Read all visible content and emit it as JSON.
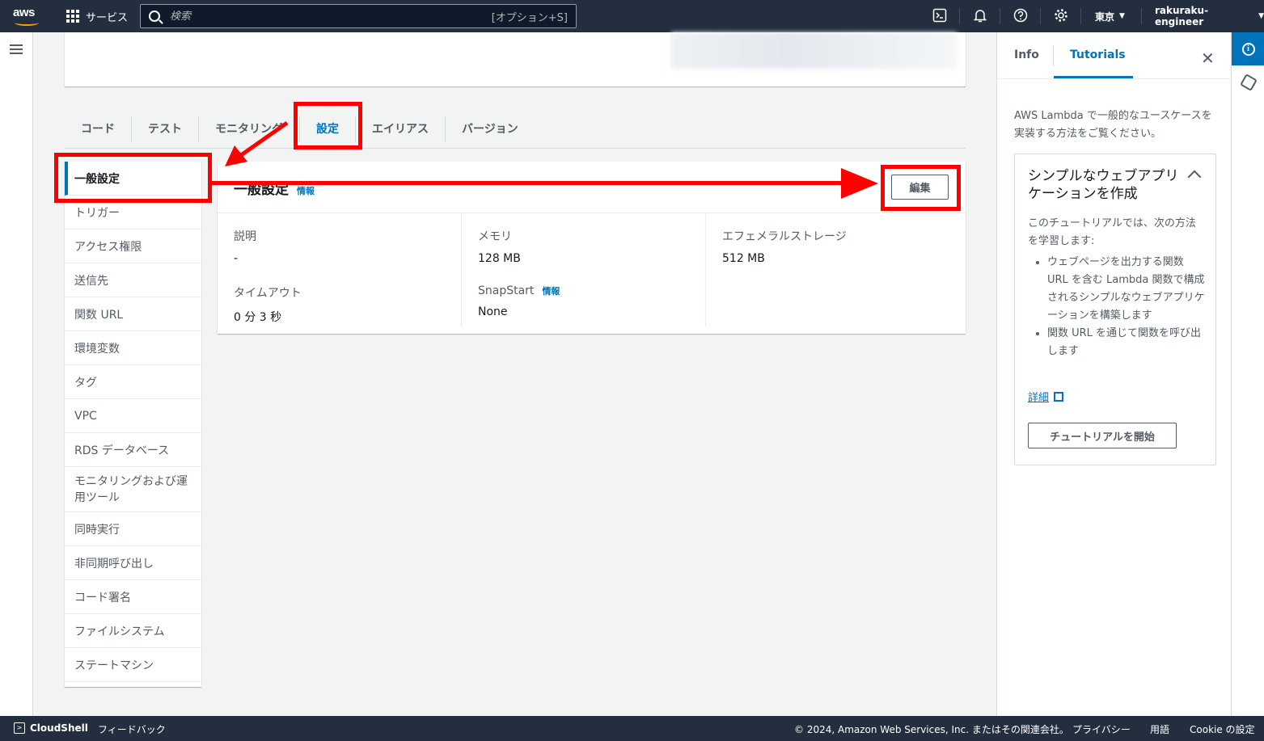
{
  "topnav": {
    "logo": "aws",
    "services_label": "サービス",
    "search_placeholder": "検索",
    "search_shortcut": "[オプション+S]",
    "region_label": "東京",
    "account_label": "rakuraku-engineer"
  },
  "tabs": [
    {
      "label": "コード"
    },
    {
      "label": "テスト"
    },
    {
      "label": "モニタリング"
    },
    {
      "label": "設定",
      "active": true
    },
    {
      "label": "エイリアス"
    },
    {
      "label": "バージョン"
    }
  ],
  "sidenav": {
    "items": [
      {
        "label": "一般設定",
        "active": true
      },
      {
        "label": "トリガー"
      },
      {
        "label": "アクセス権限"
      },
      {
        "label": "送信先"
      },
      {
        "label": "関数 URL"
      },
      {
        "label": "環境変数"
      },
      {
        "label": "タグ"
      },
      {
        "label": "VPC"
      },
      {
        "label": "RDS データベース"
      },
      {
        "label": "モニタリングおよび運用ツール"
      },
      {
        "label": "同時実行"
      },
      {
        "label": "非同期呼び出し"
      },
      {
        "label": "コード署名"
      },
      {
        "label": "ファイルシステム"
      },
      {
        "label": "ステートマシン"
      }
    ]
  },
  "general": {
    "title": "一般設定",
    "info_link": "情報",
    "edit_label": "編集",
    "description_label": "説明",
    "description_value": "-",
    "memory_label": "メモリ",
    "memory_value": "128  MB",
    "ephemeral_label": "エフェメラルストレージ",
    "ephemeral_value": "512  MB",
    "timeout_label": "タイムアウト",
    "timeout_value": "0 分  3 秒",
    "snapstart_label": "SnapStart",
    "snapstart_info": "情報",
    "snapstart_value": "None"
  },
  "rightpanel": {
    "tab_info": "Info",
    "tab_tutorials": "Tutorials",
    "intro": "AWS Lambda で一般的なユースケースを実装する方法をご覧ください。",
    "card_title": "シンプルなウェブアプリケーションを作成",
    "card_desc": "このチュートリアルでは、次の方法を学習します:",
    "bullets": [
      "ウェブページを出力する関数 URL を含む Lambda 関数で構成されるシンプルなウェブアプリケーションを構築します",
      "関数 URL を通じて関数を呼び出します"
    ],
    "detail_link": "詳細",
    "start_button": "チュートリアルを開始"
  },
  "footer": {
    "cloudshell": "CloudShell",
    "feedback": "フィードバック",
    "copyright": "© 2024, Amazon Web Services, Inc. またはその関連会社。",
    "privacy": "プライバシー",
    "terms": "用語",
    "cookie": "Cookie の設定"
  },
  "colors": {
    "nav_bg": "#232f3e",
    "accent_blue": "#0073bb",
    "annotation_red": "#ff0000"
  }
}
